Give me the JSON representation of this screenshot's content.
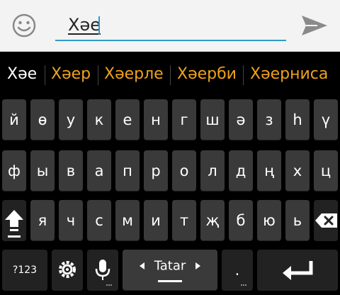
{
  "compose": {
    "input_value": "Хәе",
    "emoji_icon": "smiley-face-icon",
    "send_icon": "send-arrow-icon"
  },
  "suggestions": [
    "Хәе",
    "Хәер",
    "Хәерле",
    "Хәерби",
    "Хәерниса"
  ],
  "keyboard": {
    "row1": [
      "й",
      "ө",
      "у",
      "к",
      "е",
      "н",
      "г",
      "ш",
      "ә",
      "з",
      "һ",
      "ү"
    ],
    "row2": [
      "ф",
      "ы",
      "в",
      "а",
      "п",
      "р",
      "о",
      "л",
      "д",
      "ң",
      "х",
      "ц"
    ],
    "row3": [
      "я",
      "ч",
      "с",
      "м",
      "и",
      "т",
      "җ",
      "б",
      "ю",
      "ь"
    ],
    "symbols_label": "?123",
    "space_label": "Tatar",
    "period_label": ".",
    "shift_icon": "shift-arrow-icon",
    "backspace_icon": "backspace-icon",
    "settings_icon": "settings-gear-icon",
    "mic_icon": "microphone-icon",
    "enter_icon": "enter-return-icon"
  }
}
